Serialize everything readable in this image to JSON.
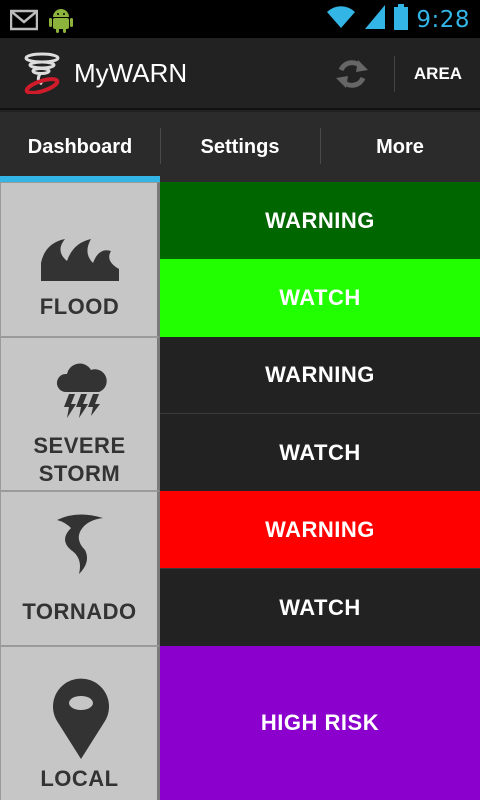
{
  "status_bar": {
    "time": "9:28",
    "icons": [
      "gmail-icon",
      "android-icon",
      "wifi-icon",
      "signal-icon",
      "battery-icon"
    ]
  },
  "action_bar": {
    "title": "MyWARN",
    "area_label": "AREA",
    "icons": [
      "tornado-logo-icon",
      "refresh-icon"
    ]
  },
  "tabs": [
    {
      "label": "Dashboard",
      "selected": true
    },
    {
      "label": "Settings",
      "selected": false
    },
    {
      "label": "More",
      "selected": false
    }
  ],
  "categories": [
    {
      "id": "flood",
      "label": "FLOOD",
      "icon": "flood-wave-icon"
    },
    {
      "id": "severe_storm",
      "label_line1": "SEVERE",
      "label_line2": "STORM",
      "icon": "storm-cloud-icon"
    },
    {
      "id": "tornado",
      "label": "TORNADO",
      "icon": "tornado-icon"
    },
    {
      "id": "local",
      "label": "LOCAL",
      "icon": "map-pin-icon"
    }
  ],
  "statuses": {
    "flood_warning": {
      "label": "WARNING",
      "color": "#006600"
    },
    "flood_watch": {
      "label": "WATCH",
      "color": "#22ff00"
    },
    "storm_warning": {
      "label": "WARNING",
      "color": "#222222"
    },
    "storm_watch": {
      "label": "WATCH",
      "color": "#222222"
    },
    "tornado_warning": {
      "label": "WARNING",
      "color": "#ff0000"
    },
    "tornado_watch": {
      "label": "WATCH",
      "color": "#222222"
    },
    "local_risk": {
      "label": "HIGH RISK",
      "color": "#8b00cc"
    }
  },
  "colors": {
    "accent": "#33b5e5",
    "tile_background": "#c6c6c6"
  }
}
